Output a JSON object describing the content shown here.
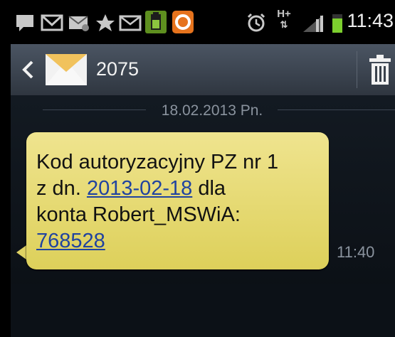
{
  "status_bar": {
    "time": "11:43",
    "network_label": "H+"
  },
  "header": {
    "contact": "2075"
  },
  "thread": {
    "date_separator": "18.02.2013 Pn.",
    "message": {
      "line1": "Kod autoryzacyjny PZ nr 1",
      "line2_prefix": "z dn. ",
      "line2_link": "2013-02-18",
      "line2_suffix": " dla",
      "line3": "konta Robert_MSWiA:",
      "line4_link": "768528",
      "time": "11:40"
    }
  },
  "colors": {
    "bubble": "#e8dc79",
    "link": "#2043a0",
    "header": "#3f4852"
  }
}
